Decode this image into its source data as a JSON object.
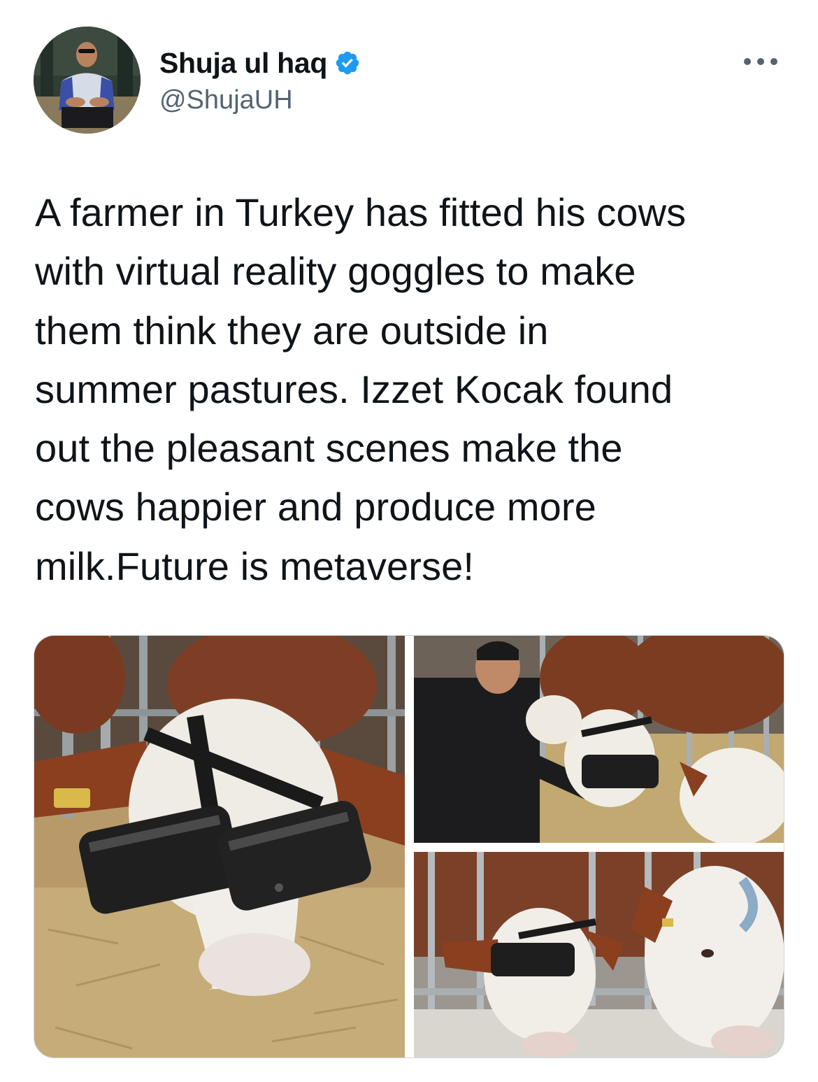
{
  "author": {
    "display_name": "Shuja ul haq",
    "handle": "@ShujaUH",
    "verified": true,
    "avatar_icon": "profile-photo"
  },
  "more_icon": "ellipsis-icon",
  "tweet": {
    "text": "A farmer in Turkey has fitted his cows\nwith virtual reality goggles to make\nthem think they are outside in\nsummer pastures. Izzet Kocak found\nout the pleasant scenes make the\ncows happier and produce more\nmilk.Future is metaverse!"
  },
  "media": {
    "count": 3
  },
  "colors": {
    "text": "#0f1419",
    "secondary": "#536471",
    "verified": "#1d9bf0",
    "border": "#cfd9de"
  }
}
